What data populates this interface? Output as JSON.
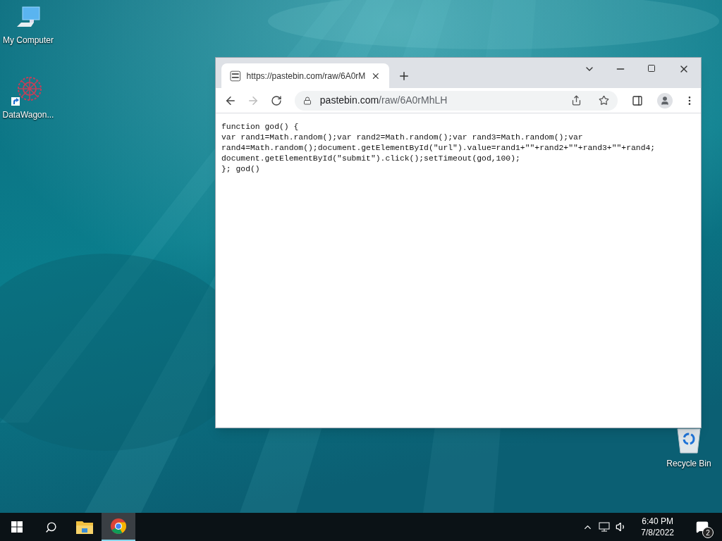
{
  "desktop_icons": [
    {
      "label": "My Computer",
      "kind": "computer"
    },
    {
      "label": "DataWagon...",
      "kind": "shortcut"
    },
    {
      "label": "Recycle Bin",
      "kind": "recycle"
    }
  ],
  "browser": {
    "tabs": [
      {
        "title": "https://pastebin.com/raw/6A0rM",
        "selected": true
      }
    ],
    "navigation": {
      "back_enabled": true,
      "forward_enabled": false
    },
    "address": {
      "host": "pastebin.com",
      "path": "/raw/6A0rMhLH"
    },
    "content_lines": [
      "function god() {",
      "var rand1=Math.random();var rand2=Math.random();var rand3=Math.random();var",
      "rand4=Math.random();document.getElementById(\"url\").value=rand1+\"\"+rand2+\"\"+rand3+\"\"+rand4;",
      "document.getElementById(\"submit\").click();setTimeout(god,100);",
      "}; god()"
    ]
  },
  "taskbar": {
    "apps": [
      {
        "kind": "explorer",
        "selected": false
      },
      {
        "kind": "chrome",
        "selected": true
      }
    ],
    "clock": {
      "time": "6:40 PM",
      "date": "7/8/2022"
    },
    "notifications": {
      "count": "2"
    }
  }
}
